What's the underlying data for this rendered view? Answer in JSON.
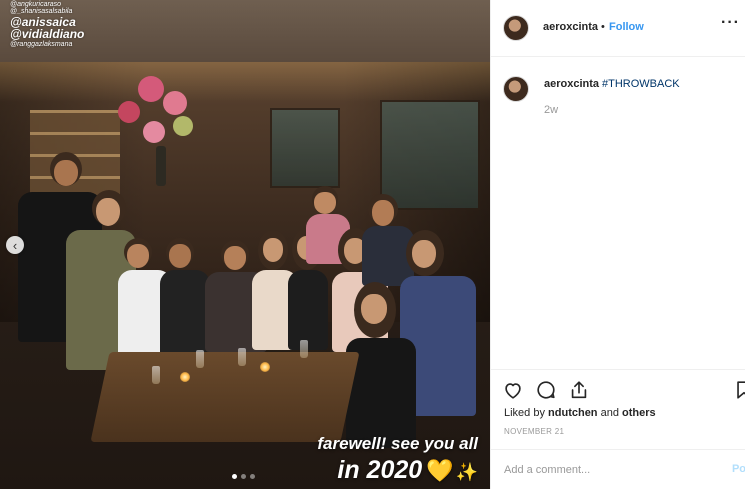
{
  "photo": {
    "tags": [
      "@angkuricaraso",
      "@_shanisasalsabila",
      "@anissaica",
      "@vidialdiano",
      "@ranggazlaksmana"
    ],
    "caption_line1": "farewell! see you all",
    "caption_line2": "in 2020",
    "caption_emoji_heart": "💛",
    "caption_emoji_sparkle": "✨",
    "carousel": {
      "prev_glyph": "‹",
      "total": 3,
      "active": 1
    }
  },
  "post": {
    "header": {
      "username": "aeroxcinta",
      "separator": "•",
      "follow_label": "Follow",
      "more_glyph": "···"
    },
    "comment": {
      "username": "aeroxcinta",
      "hashtag": "#THROWBACK",
      "time": "2w"
    },
    "likes": {
      "prefix": "Liked by ",
      "user": "ndutchen",
      "middle": " and ",
      "others": "others"
    },
    "date": "NOVEMBER 21",
    "add_comment": {
      "placeholder": "Add a comment...",
      "post_label": "Po"
    }
  },
  "icons": [
    "heart-icon",
    "comment-icon",
    "share-icon",
    "bookmark-icon",
    "chevron-left-icon",
    "more-icon"
  ],
  "colors": {
    "link": "#3897f0",
    "hashtag": "#003569",
    "muted": "#999999",
    "post_disabled": "#b2dffc"
  }
}
